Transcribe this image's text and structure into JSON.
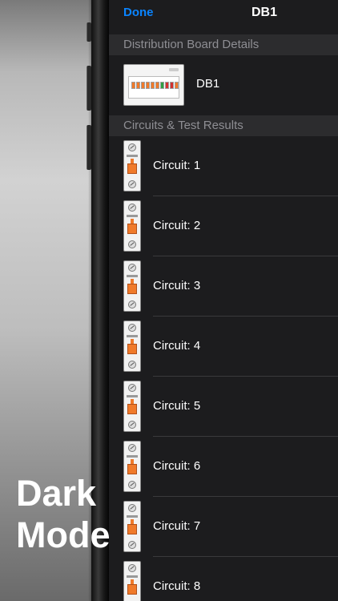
{
  "navbar": {
    "done_label": "Done",
    "title": "DB1"
  },
  "sections": {
    "board_details": "Distribution Board Details",
    "circuits": "Circuits & Test Results"
  },
  "board": {
    "name": "DB1"
  },
  "circuits": [
    {
      "label": "Circuit: 1"
    },
    {
      "label": "Circuit: 2"
    },
    {
      "label": "Circuit: 3"
    },
    {
      "label": "Circuit: 4"
    },
    {
      "label": "Circuit: 5"
    },
    {
      "label": "Circuit: 6"
    },
    {
      "label": "Circuit: 7"
    },
    {
      "label": "Circuit: 8"
    }
  ],
  "promo": {
    "text": "Dark\nMode"
  },
  "colors": {
    "accent": "#0a84ff",
    "background": "#1c1c1e",
    "header": "#2c2c2e",
    "breaker_orange": "#f07a2a"
  }
}
